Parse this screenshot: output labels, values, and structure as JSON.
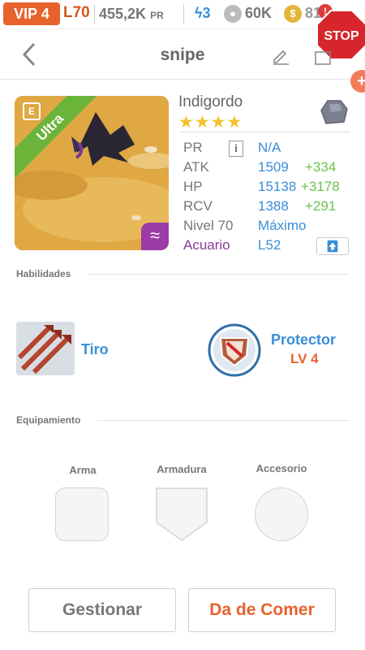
{
  "status": {
    "vip": "VIP 4",
    "level": "L70",
    "power": "455,2K",
    "power_unit": "PR",
    "energy": "3",
    "food": "60K",
    "coins": "81",
    "badge": "!",
    "stop_sign": "STOP"
  },
  "header": {
    "title": "snipe"
  },
  "pet": {
    "name": "Indigordo",
    "rarity": "Ultra",
    "stars": "★★★★",
    "stats": [
      {
        "key": "PR",
        "value": "N/A",
        "bonus": ""
      },
      {
        "key": "ATK",
        "value": "1509",
        "bonus": "+334"
      },
      {
        "key": "HP",
        "value": "15138",
        "bonus": "+3178"
      },
      {
        "key": "RCV",
        "value": "1388",
        "bonus": "+291"
      },
      {
        "key": "Nivel 70",
        "value": "Máximo",
        "bonus": ""
      },
      {
        "key": "Acuario",
        "value": "L52",
        "bonus": ""
      }
    ]
  },
  "skills": {
    "heading": "Habilidades",
    "items": [
      {
        "name": "Tiro",
        "level": ""
      },
      {
        "name": "Protector",
        "level": "LV 4"
      }
    ]
  },
  "equipment": {
    "heading": "Equipamiento",
    "slots": [
      "Arma",
      "Armadura",
      "Accesorio"
    ]
  },
  "actions": {
    "manage": "Gestionar",
    "feed": "Da de Comer"
  },
  "colors": {
    "accent_orange": "#e8622c",
    "accent_blue": "#3a8ed8",
    "bonus_green": "#6bc24b",
    "aquarium_purple": "#8b3a9c"
  }
}
